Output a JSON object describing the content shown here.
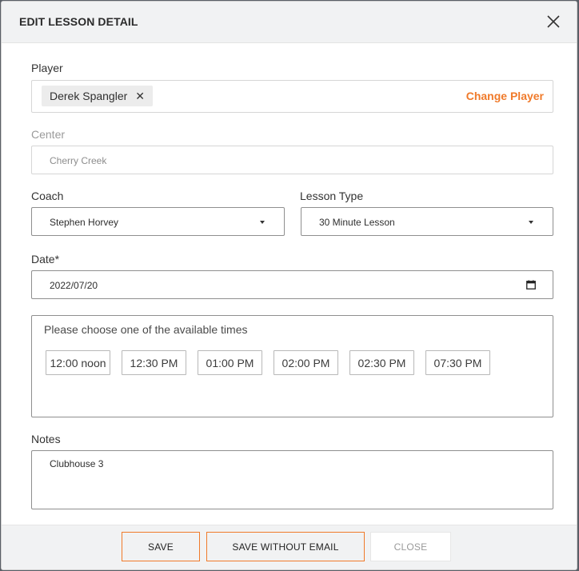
{
  "dialog": {
    "title": "EDIT LESSON DETAIL"
  },
  "player": {
    "label": "Player",
    "selected": "Derek Spangler",
    "change_label": "Change Player"
  },
  "center": {
    "label": "Center",
    "value": "Cherry Creek"
  },
  "coach": {
    "label": "Coach",
    "value": "Stephen Horvey"
  },
  "lesson_type": {
    "label": "Lesson Type",
    "value": "30 Minute Lesson"
  },
  "date": {
    "label": "Date*",
    "value": "2022/07/20"
  },
  "times": {
    "title": "Please choose one of the available times",
    "slots": [
      "12:00 noon",
      "12:30 PM",
      "01:00 PM",
      "02:00 PM",
      "02:30 PM",
      "07:30 PM"
    ]
  },
  "notes": {
    "label": "Notes",
    "value": "Clubhouse 3"
  },
  "footer": {
    "save": "SAVE",
    "save_without_email": "SAVE WITHOUT EMAIL",
    "close": "CLOSE"
  },
  "colors": {
    "accent": "#f07a2a",
    "header_bg": "#f1f2f3"
  },
  "icons": {
    "close": "close-icon",
    "remove_chip": "close-icon",
    "dropdown": "caret-down-icon",
    "date": "calendar-icon"
  }
}
